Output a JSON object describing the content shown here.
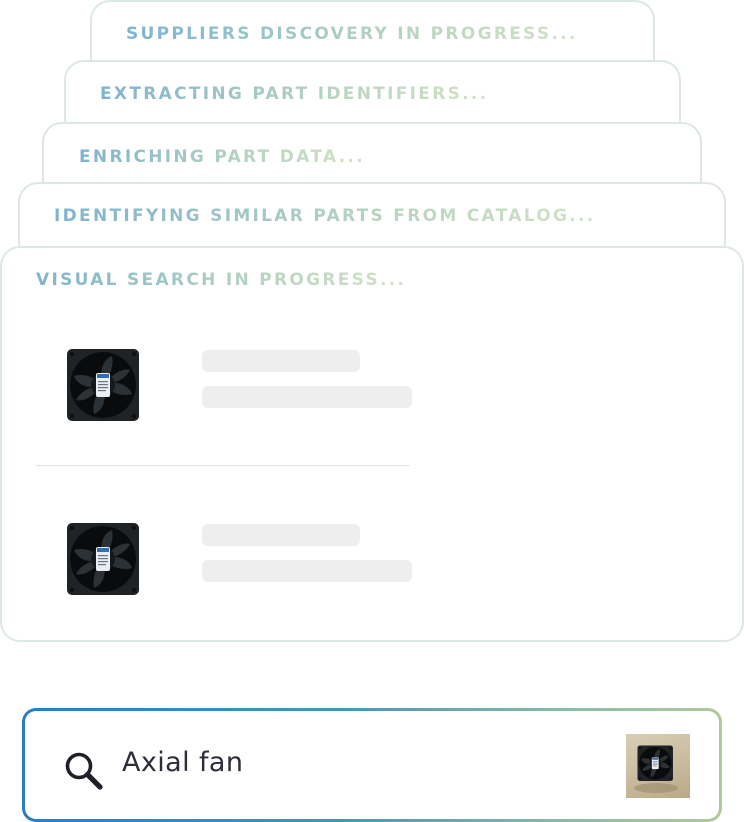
{
  "steps": [
    {
      "label": "SUPPLIERS DISCOVERY IN PROGRESS..."
    },
    {
      "label": "EXTRACTING PART IDENTIFIERS..."
    },
    {
      "label": "ENRICHING PART DATA..."
    },
    {
      "label": "IDENTIFYING SIMILAR PARTS FROM CATALOG..."
    },
    {
      "label": "VISUAL SEARCH IN PROGRESS..."
    }
  ],
  "results": [
    {
      "thumbnail_icon": "axial-fan-icon",
      "loading": true
    },
    {
      "thumbnail_icon": "axial-fan-icon",
      "loading": true
    }
  ],
  "search": {
    "query": "Axial fan",
    "icon": "magnifier-icon",
    "attached_image_icon": "axial-fan-photo"
  },
  "colors": {
    "title_gradient_start": "#7fb3cf",
    "title_gradient_end": "#d4e2c8",
    "search_border_start": "#2b7cc4",
    "search_border_end": "#b2c89a",
    "card_border": "#dde8e4",
    "skeleton": "#eeeeee"
  }
}
